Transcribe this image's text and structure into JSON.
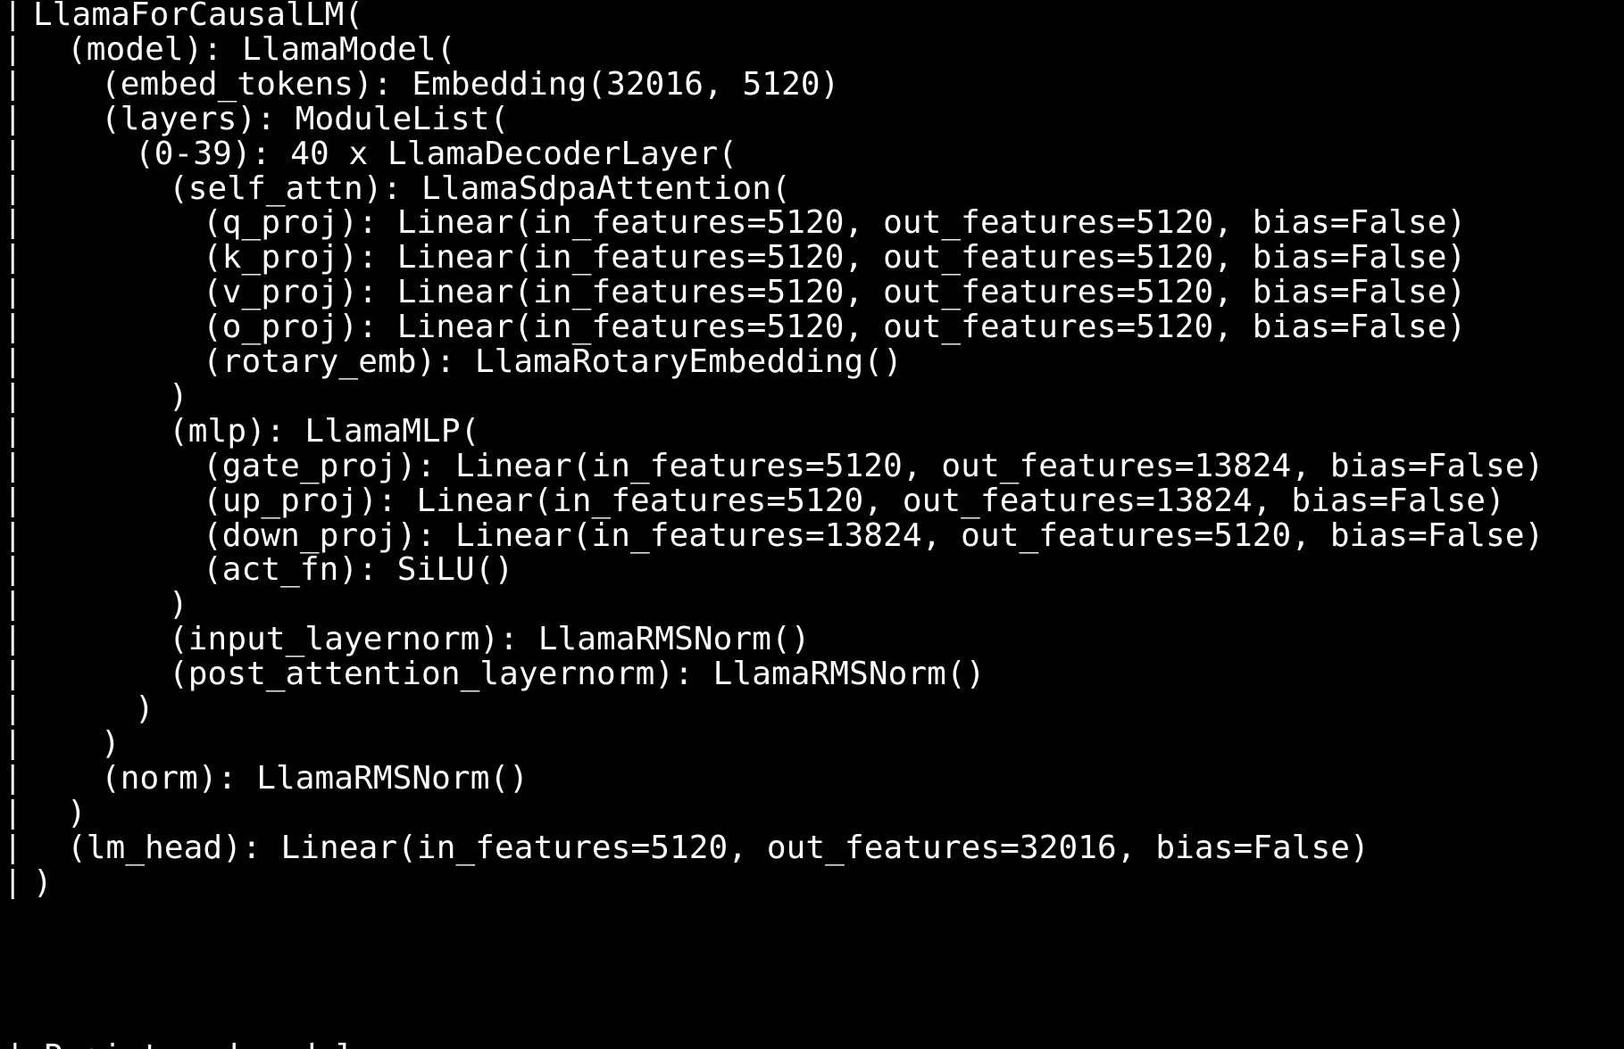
{
  "terminal": {
    "border_char": "|",
    "lines": [
      {
        "indent": 0,
        "text": "LlamaForCausalLM("
      },
      {
        "indent": 1,
        "text": "(model): LlamaModel("
      },
      {
        "indent": 2,
        "text": "(embed_tokens): Embedding(32016, 5120)"
      },
      {
        "indent": 2,
        "text": "(layers): ModuleList("
      },
      {
        "indent": 3,
        "text": "(0-39): 40 x LlamaDecoderLayer("
      },
      {
        "indent": 4,
        "text": "(self_attn): LlamaSdpaAttention("
      },
      {
        "indent": 5,
        "text": "(q_proj): Linear(in_features=5120, out_features=5120, bias=False)"
      },
      {
        "indent": 5,
        "text": "(k_proj): Linear(in_features=5120, out_features=5120, bias=False)"
      },
      {
        "indent": 5,
        "text": "(v_proj): Linear(in_features=5120, out_features=5120, bias=False)"
      },
      {
        "indent": 5,
        "text": "(o_proj): Linear(in_features=5120, out_features=5120, bias=False)"
      },
      {
        "indent": 5,
        "text": "(rotary_emb): LlamaRotaryEmbedding()"
      },
      {
        "indent": 4,
        "text": ")"
      },
      {
        "indent": 4,
        "text": "(mlp): LlamaMLP("
      },
      {
        "indent": 5,
        "text": "(gate_proj): Linear(in_features=5120, out_features=13824, bias=False)"
      },
      {
        "indent": 5,
        "text": "(up_proj): Linear(in_features=5120, out_features=13824, bias=False)"
      },
      {
        "indent": 5,
        "text": "(down_proj): Linear(in_features=13824, out_features=5120, bias=False)"
      },
      {
        "indent": 5,
        "text": "(act_fn): SiLU()"
      },
      {
        "indent": 4,
        "text": ")"
      },
      {
        "indent": 4,
        "text": "(input_layernorm): LlamaRMSNorm()"
      },
      {
        "indent": 4,
        "text": "(post_attention_layernorm): LlamaRMSNorm()"
      },
      {
        "indent": 3,
        "text": ")"
      },
      {
        "indent": 2,
        "text": ")"
      },
      {
        "indent": 2,
        "text": "(norm): LlamaRMSNorm()"
      },
      {
        "indent": 1,
        "text": ")"
      },
      {
        "indent": 1,
        "text": "(lm_head): Linear(in_features=5120, out_features=32016, bias=False)"
      },
      {
        "indent": 0,
        "text": ")"
      }
    ],
    "cutoff_line": "| Registered model"
  }
}
